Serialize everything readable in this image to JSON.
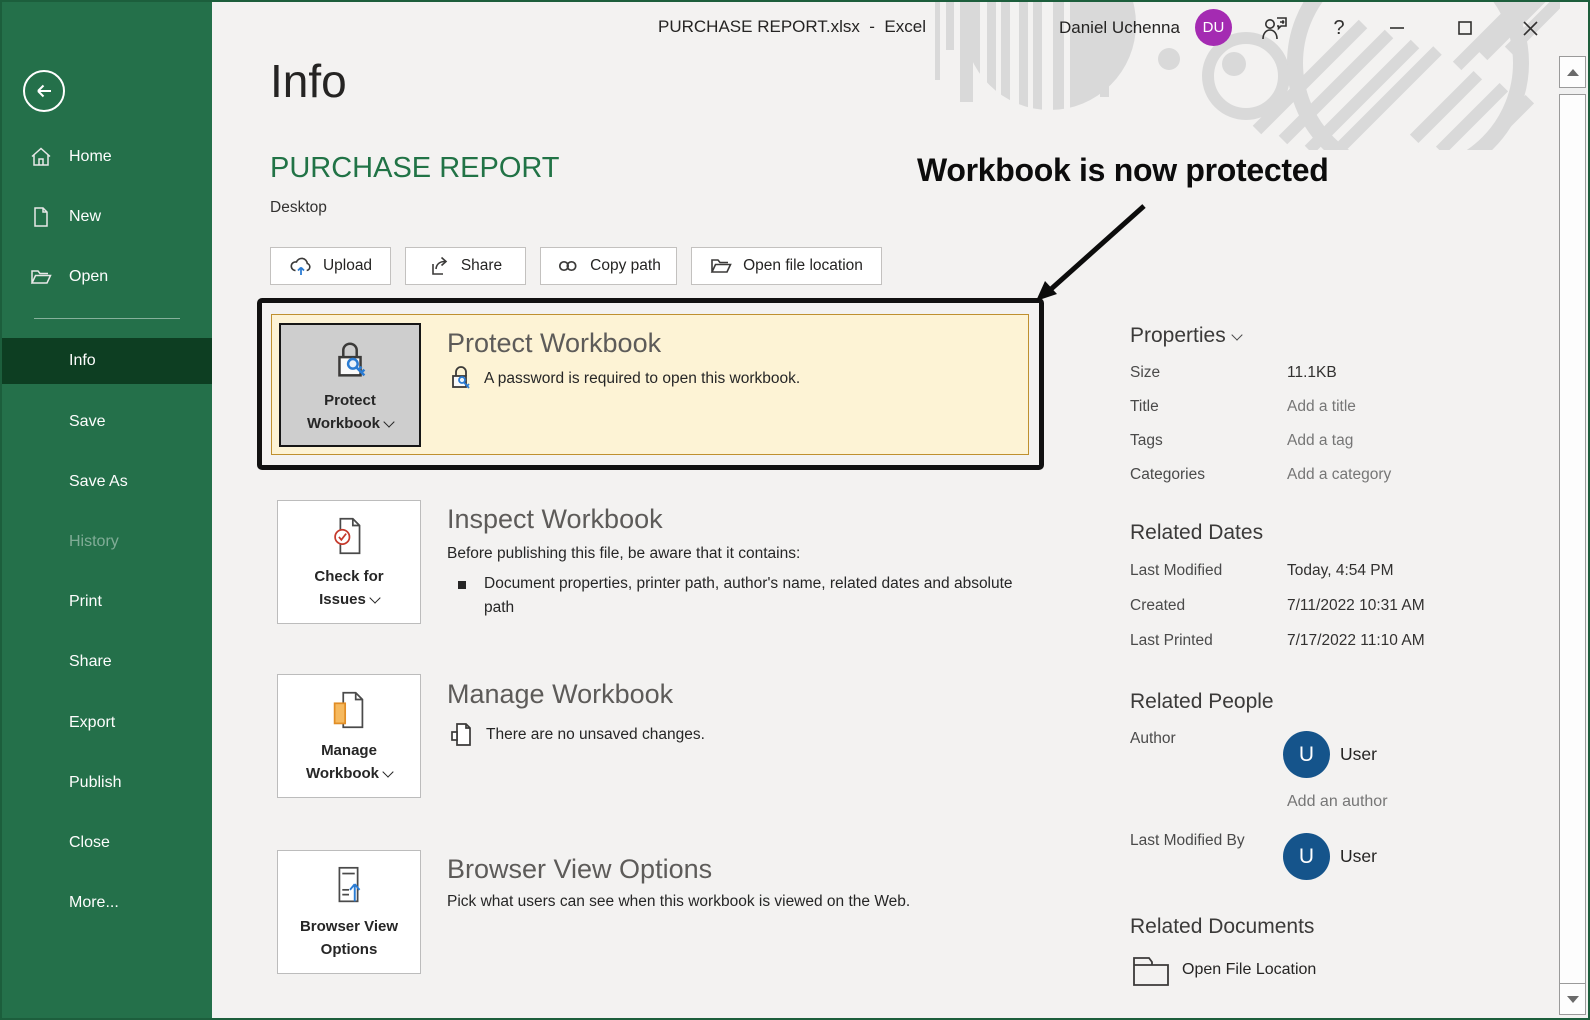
{
  "window": {
    "title": "PURCHASE REPORT.xlsx  -  Excel",
    "user_name": "Daniel Uchenna",
    "user_initials": "DU",
    "help_label": "?"
  },
  "sidebar": {
    "items": [
      {
        "label": "Home"
      },
      {
        "label": "New"
      },
      {
        "label": "Open"
      },
      {
        "label": "Info"
      },
      {
        "label": "Save"
      },
      {
        "label": "Save As"
      },
      {
        "label": "History"
      },
      {
        "label": "Print"
      },
      {
        "label": "Share"
      },
      {
        "label": "Export"
      },
      {
        "label": "Publish"
      },
      {
        "label": "Close"
      },
      {
        "label": "More..."
      }
    ]
  },
  "main": {
    "page_title": "Info",
    "doc_title": "PURCHASE REPORT",
    "doc_location": "Desktop",
    "actions": [
      {
        "label": "Upload"
      },
      {
        "label": "Share"
      },
      {
        "label": "Copy path"
      },
      {
        "label": "Open file location"
      }
    ],
    "annotation": "Workbook is now protected",
    "protect": {
      "tile_line1": "Protect",
      "tile_line2": "Workbook",
      "heading": "Protect Workbook",
      "description": "A password is required to open this workbook."
    },
    "inspect": {
      "tile_line1": "Check for",
      "tile_line2": "Issues",
      "heading": "Inspect Workbook",
      "description": "Before publishing this file, be aware that it contains:",
      "bullet": "Document properties, printer path, author's name, related dates and absolute path"
    },
    "manage": {
      "tile_line1": "Manage",
      "tile_line2": "Workbook",
      "heading": "Manage Workbook",
      "description": "There are no unsaved changes."
    },
    "browser": {
      "tile_line1": "Browser View",
      "tile_line2": "Options",
      "heading": "Browser View Options",
      "description": "Pick what users can see when this workbook is viewed on the Web."
    }
  },
  "panel": {
    "properties_title": "Properties",
    "properties": [
      {
        "label": "Size",
        "value": "11.1KB"
      },
      {
        "label": "Title",
        "value": "Add a title"
      },
      {
        "label": "Tags",
        "value": "Add a tag"
      },
      {
        "label": "Categories",
        "value": "Add a category"
      }
    ],
    "related_dates": {
      "heading": "Related Dates",
      "rows": [
        {
          "label": "Last Modified",
          "value": "Today, 4:54 PM"
        },
        {
          "label": "Created",
          "value": "7/11/2022 10:31 AM"
        },
        {
          "label": "Last Printed",
          "value": "7/17/2022 11:10 AM"
        }
      ]
    },
    "related_people": {
      "heading": "Related People",
      "author_label": "Author",
      "author_initial": "U",
      "author_name": "User",
      "add_author": "Add an author",
      "modified_label": "Last Modified By",
      "modified_initial": "U",
      "modified_name": "User"
    },
    "related_documents": {
      "heading": "Related Documents",
      "open_file_location": "Open File Location"
    }
  },
  "colors": {
    "excel_green": "#24704a",
    "sidebar_selected_green": "#0d3e22",
    "doc_title_green": "#217346",
    "highlight_fill": "#fdf3d5",
    "highlight_border": "#bf902f",
    "annotation_black": "#0c0c0c",
    "avatar_blue": "#15548b",
    "user_badge_purple": "#a42bb2",
    "accent_blue": "#2b7cd3",
    "issue_red": "#c5392b",
    "manage_orange": "#f2a33c"
  }
}
